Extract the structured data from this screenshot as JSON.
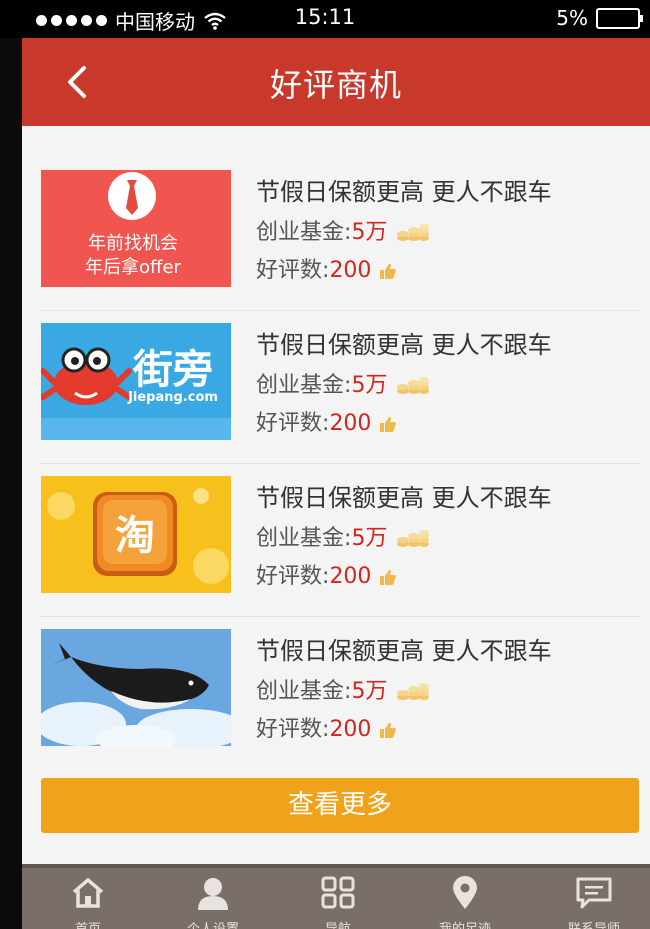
{
  "status_bar": {
    "carrier": "中国移动",
    "time": "15:11",
    "battery": "5%"
  },
  "navbar": {
    "title": "好评商机",
    "back_icon": "chevron-left-icon"
  },
  "items": [
    {
      "title": "节假日保额更高  更人不跟车",
      "fund_label": "创业基金",
      "fund_value": "5万",
      "review_label": "好评数",
      "review_value": "200",
      "thumb": {
        "kind": "tie",
        "line1": "年前找机会",
        "line2": "年后拿offer",
        "bg": "#f0564f"
      }
    },
    {
      "title": "节假日保额更高  更人不跟车",
      "fund_label": "创业基金",
      "fund_value": "5万",
      "review_label": "好评数",
      "review_value": "200",
      "thumb": {
        "kind": "jiepang",
        "brand": "街旁",
        "domain": "Jiepang.com",
        "bg": "#3aa9e3"
      }
    },
    {
      "title": "节假日保额更高  更人不跟车",
      "fund_label": "创业基金",
      "fund_value": "5万",
      "review_label": "好评数",
      "review_value": "200",
      "thumb": {
        "kind": "taobao",
        "glyph": "淘",
        "bg": "#f8c01d"
      }
    },
    {
      "title": "节假日保额更高  更人不跟车",
      "fund_label": "创业基金",
      "fund_value": "5万",
      "review_label": "好评数",
      "review_value": "200",
      "thumb": {
        "kind": "whale",
        "bg": "#6aa6e0"
      }
    }
  ],
  "more_button": "查看更多",
  "tabbar": {
    "tabs": [
      {
        "label": "首页",
        "icon": "home-icon"
      },
      {
        "label": "个人设置",
        "icon": "user-icon"
      },
      {
        "label": "导航",
        "icon": "grid-icon"
      },
      {
        "label": "我的足迹",
        "icon": "location-pin-icon"
      },
      {
        "label": "联系导师",
        "icon": "message-icon"
      }
    ]
  },
  "colors": {
    "nav_red": "#c8382b",
    "price_red": "#d0261c",
    "button_orange": "#f0a21a",
    "tabbar": "#7a6f68"
  }
}
